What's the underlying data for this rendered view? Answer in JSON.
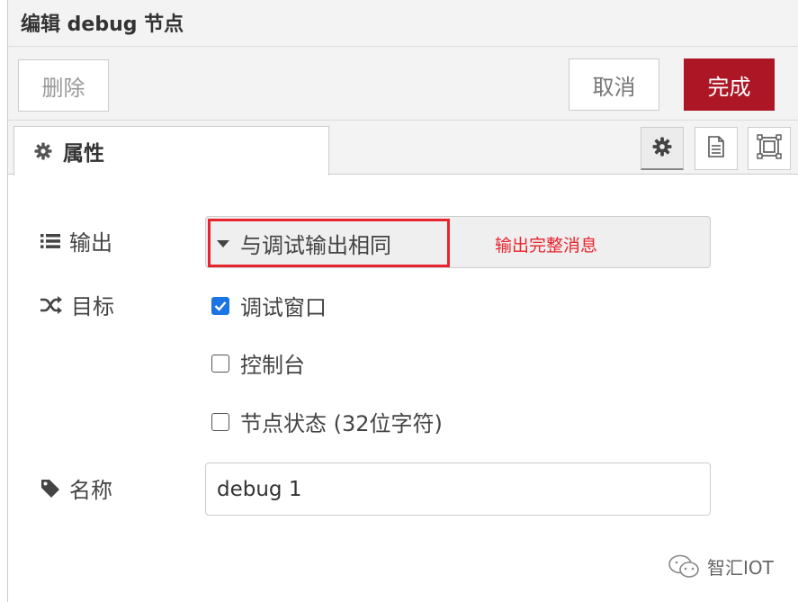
{
  "header": {
    "title": "编辑 debug 节点"
  },
  "toolbar": {
    "delete_label": "删除",
    "cancel_label": "取消",
    "done_label": "完成",
    "done_color": "#ad1625"
  },
  "tabs": {
    "properties_label": "属性",
    "icons": [
      "gear-icon",
      "document-icon",
      "appearance-icon"
    ]
  },
  "form": {
    "output": {
      "label": "输出",
      "icon": "list-icon",
      "selected": "与调试输出相同"
    },
    "target": {
      "label": "目标",
      "icon": "shuffle-icon",
      "options": [
        {
          "label": "调试窗口",
          "checked": true
        },
        {
          "label": "控制台",
          "checked": false
        },
        {
          "label": "节点状态 (32位字符)",
          "checked": false
        }
      ]
    },
    "name": {
      "label": "名称",
      "icon": "tag-icon",
      "value": "debug 1"
    }
  },
  "annotation": {
    "text": "输出完整消息",
    "color": "#e8252e"
  },
  "watermark": {
    "text": "智汇IOT",
    "icon": "wechat-icon"
  }
}
